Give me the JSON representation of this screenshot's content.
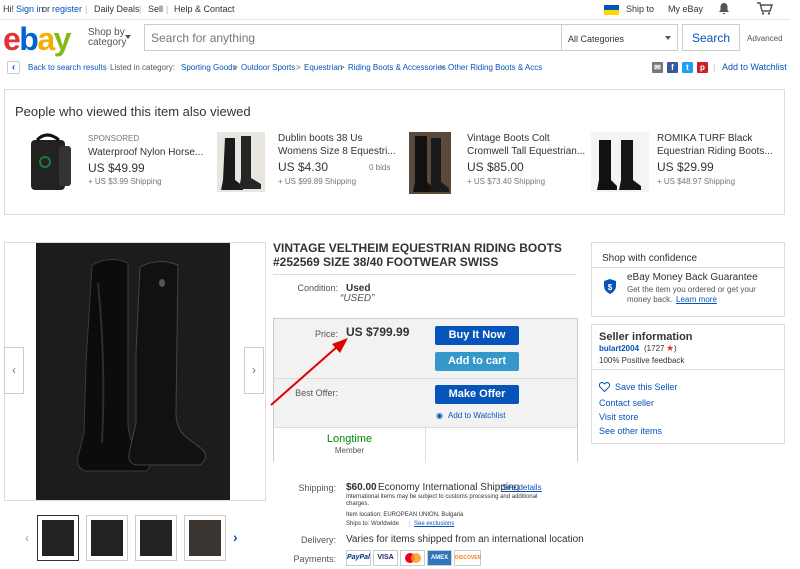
{
  "topbar": {
    "greeting": "Hi!",
    "sign_in": "Sign in",
    "or": "or",
    "register": "register",
    "daily_deals": "Daily Deals",
    "sell": "Sell",
    "help": "Help & Contact",
    "ship_to": "Ship to",
    "my_ebay": "My eBay"
  },
  "header": {
    "logo": {
      "e": "e",
      "b": "b",
      "a": "a",
      "y": "y"
    },
    "shop_by_1": "Shop by",
    "shop_by_2": "category",
    "search_placeholder": "Search for anything",
    "category": "All Categories",
    "search_button": "Search",
    "advanced": "Advanced"
  },
  "breadcrumb": {
    "back": "Back to search results",
    "listed_in": "Listed in category:",
    "items": [
      "Sporting Goods",
      "Outdoor Sports",
      "Equestrian",
      "Riding Boots & Accessories",
      "Other Riding Boots & Accs"
    ],
    "add_watchlist": "Add to Watchlist"
  },
  "also_viewed": {
    "heading": "People who viewed this item also viewed",
    "items": [
      {
        "sponsored": "SPONSORED",
        "title": "Waterproof Nylon Horse...",
        "price": "US $49.99",
        "shipping": "+ US $3.99 Shipping",
        "bids": ""
      },
      {
        "sponsored": "",
        "title_1": "Dublin boots 38 Us",
        "title_2": "Womens Size 8 Equestri...",
        "price": "US $4.30",
        "shipping": "+ US $99.89 Shipping",
        "bids": "0 bids"
      },
      {
        "sponsored": "",
        "title_1": "Vintage Boots Colt",
        "title_2": "Cromwell Tall Equestrian...",
        "price": "US $85.00",
        "shipping": "+ US $73.40 Shipping",
        "bids": ""
      },
      {
        "sponsored": "",
        "title_1": "ROMIKA TURF Black",
        "title_2": "Equestrian Riding Boots...",
        "price": "US $29.99",
        "shipping": "+ US $48.97 Shipping",
        "bids": ""
      }
    ]
  },
  "item": {
    "title": "VINTAGE VELTHEIM EQUESTRIAN RIDING BOOTS #252569 SIZE 38/40 FOOTWEAR SWISS",
    "condition_label": "Condition:",
    "condition": "Used",
    "condition_quote": "“USED”",
    "price_label": "Price:",
    "price": "US $799.99",
    "buy_now": "Buy It Now",
    "add_cart": "Add to cart",
    "best_offer_label": "Best Offer:",
    "make_offer": "Make Offer",
    "add_watchlist": "Add to Watchlist",
    "longtime": "Longtime",
    "member": "Member",
    "shipping_label": "Shipping:",
    "shipping_price": "$60.00",
    "shipping_method": "Economy International Shipping",
    "see_details": "See details",
    "shipping_note_1": "International items may be subject to customs processing and additional",
    "shipping_note_2": "charges.",
    "item_location": "Item location:  EUROPEAN UNION, Bulgaria",
    "ships_to": "Ships to:  Worldwide",
    "see_exclusions": "See exclusions",
    "delivery_label": "Delivery:",
    "delivery": "Varies for items shipped from an international location",
    "payments_label": "Payments:",
    "payments": [
      "PayPal",
      "VISA",
      "MC",
      "AMEX",
      "DISCOVER"
    ]
  },
  "confidence": {
    "heading": "Shop with confidence",
    "guarantee": "eBay Money Back Guarantee",
    "desc_1": "Get the item you ordered or get your",
    "desc_2": "money back.",
    "learn_more": "Learn more"
  },
  "seller": {
    "heading": "Seller information",
    "name": "bulart2004",
    "score": "(1727",
    "score_close": ")",
    "feedback": "100% Positive feedback",
    "save": "Save this Seller",
    "contact": "Contact seller",
    "store": "Visit store",
    "other": "See other items"
  },
  "colors": {
    "accent": "#0654ba",
    "button": "#0654ba",
    "cart": "#3498ca",
    "longtime": "#008a00",
    "arrow": "#e00000"
  }
}
